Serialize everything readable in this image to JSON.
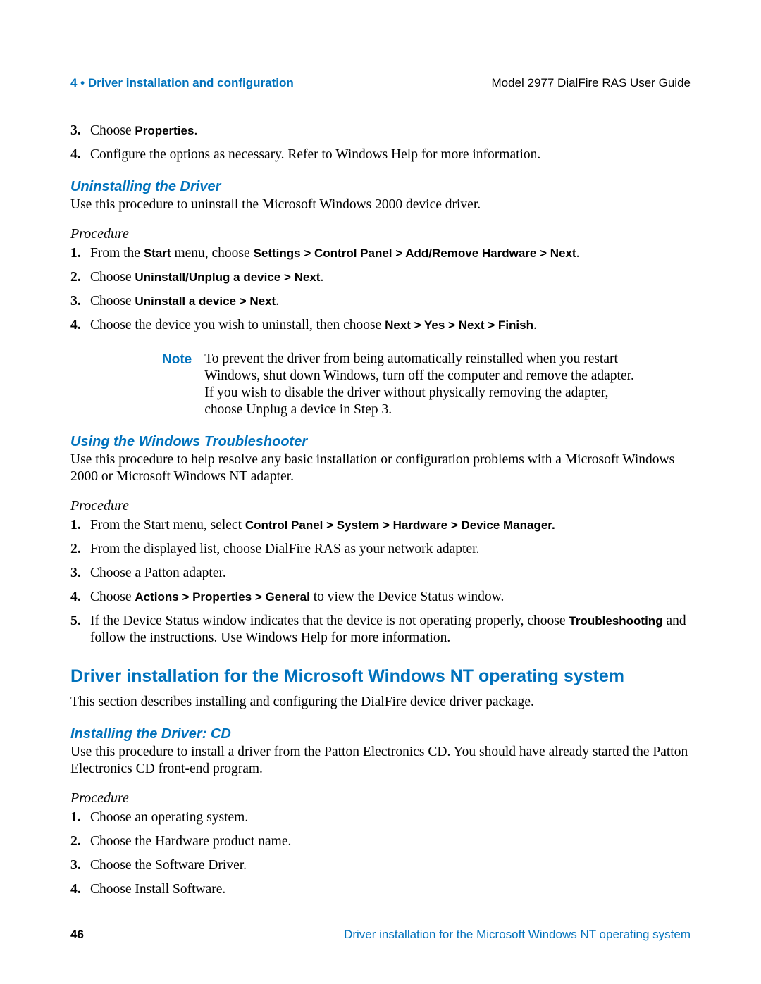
{
  "header": {
    "left": "4 • Driver installation and configuration",
    "right": "Model 2977 DialFire RAS User Guide"
  },
  "top_steps": {
    "s3_pre": "Choose ",
    "s3_bold": "Properties",
    "s3_post": ".",
    "s4": "Configure the options as necessary. Refer to Windows Help for more information."
  },
  "sec1": {
    "title": "Uninstalling the Driver",
    "intro": "Use this procedure to uninstall the Microsoft Windows 2000 device driver.",
    "proc_label": "Procedure",
    "s1_pre": "From the ",
    "s1_b1": "Start",
    "s1_mid": " menu, choose ",
    "s1_b2": "Settings > Control Panel > Add/Remove Hardware > Next",
    "s1_post": ".",
    "s2_pre": "Choose ",
    "s2_b": "Uninstall/Unplug a device > Next",
    "s2_post": ".",
    "s3_pre": "Choose ",
    "s3_b": "Uninstall a device > Next",
    "s3_post": ".",
    "s4_pre": "Choose the device you wish to uninstall, then choose ",
    "s4_b": "Next > Yes > Next > Finish",
    "s4_post": ".",
    "note_label": "Note",
    "note_body": "To prevent the driver from being automatically reinstalled when you restart Windows, shut down Windows, turn off the computer and remove the adapter. If you wish to disable the driver without physically removing the adapter, choose Unplug a device in Step 3."
  },
  "sec2": {
    "title": "Using the Windows Troubleshooter",
    "intro": "Use this procedure to help resolve any basic installation or configuration problems with a Microsoft Windows 2000 or Microsoft Windows NT adapter.",
    "proc_label": "Procedure",
    "s1_pre": "From the Start menu, select ",
    "s1_b": "Control Panel > System > Hardware > Device Manager.",
    "s2": "From the displayed list, choose DialFire RAS as your network adapter.",
    "s3": "Choose a Patton adapter.",
    "s4_pre": "Choose ",
    "s4_b": "Actions > Properties > General",
    "s4_post": " to view the Device Status window.",
    "s5_pre": "If the Device Status window indicates that the device is not operating properly, choose ",
    "s5_b": "Troubleshooting",
    "s5_post": " and follow the instructions. Use Windows Help for more information."
  },
  "sec3": {
    "title": "Driver installation for the Microsoft Windows NT operating system",
    "intro": "This section describes installing and configuring the DialFire device driver package."
  },
  "sec4": {
    "title": "Installing the Driver: CD",
    "intro": "Use this procedure to install a driver from the Patton Electronics CD. You should have already started the Patton Electronics CD front-end program.",
    "proc_label": "Procedure",
    "s1": "Choose an operating system.",
    "s2": "Choose the Hardware product name.",
    "s3": "Choose the Software Driver.",
    "s4": "Choose Install Software."
  },
  "footer": {
    "page": "46",
    "right": "Driver installation for the Microsoft Windows NT operating system"
  }
}
